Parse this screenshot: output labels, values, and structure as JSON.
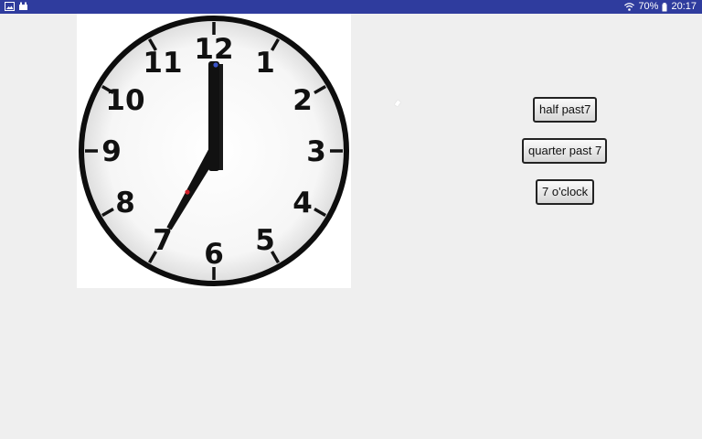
{
  "status_bar": {
    "icons_left": [
      "gallery-icon",
      "app-icon"
    ],
    "wifi_icon": "wifi-icon",
    "battery_percent": "70%",
    "battery_icon": "battery-icon",
    "time": "20:17"
  },
  "clock": {
    "numbers": [
      "12",
      "1",
      "2",
      "3",
      "4",
      "5",
      "6",
      "7",
      "8",
      "9",
      "10",
      "11"
    ],
    "time_shown": "7:00"
  },
  "buttons": {
    "option_1": "half past7",
    "option_2": "quarter past 7",
    "option_3": "7 o'clock"
  },
  "colors": {
    "status_bar": "#2f3c9e",
    "background": "#efefef"
  }
}
